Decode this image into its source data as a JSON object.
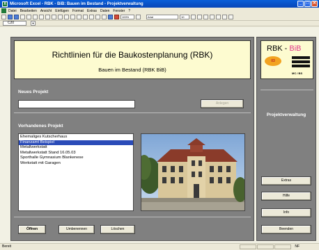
{
  "window": {
    "title": "Microsoft Excel - RBK - BiB: Bauen im Bestand - Projektverwaltung",
    "app_icon": "X",
    "buttons": [
      "_",
      "□",
      "✕"
    ]
  },
  "menu": {
    "items": [
      "Datei",
      "Bearbeiten",
      "Ansicht",
      "Einfügen",
      "Format",
      "Extras",
      "Daten",
      "Fenster",
      "?"
    ]
  },
  "toolbar": {
    "font_name": "Arial",
    "font_size": "10",
    "zoom": "100%"
  },
  "formula_bar": {
    "cell_ref": "C20",
    "dropdown_icon": "▼"
  },
  "header": {
    "title": "Richtlinien für die Baukostenplanung (RBK)",
    "subtitle": "Bauen im Bestand (RBK BiB)"
  },
  "new_project": {
    "label": "Neues Projekt",
    "input_value": "",
    "create_button": "Anlegen"
  },
  "existing_projects": {
    "label": "Vorhandenes Projekt",
    "items": [
      "Ehemaliges Kutscherhaus",
      "Finanzamt Beispiel",
      "Metallwerkstatt",
      "Metallwerkstatt Stand 16.05.03",
      "Sporthalle Gymnasium Blankenese",
      "Werkstatt mit Garagen"
    ],
    "selected_index": 1,
    "buttons": {
      "open": "Öffnen",
      "rename": "Umbenennen",
      "delete": "Löschen"
    }
  },
  "logo": {
    "rbk": "RBK - ",
    "bib": "BiB",
    "disc": "03",
    "small": "MC / BS"
  },
  "side": {
    "label": "Projektverwaltung",
    "buttons": [
      "Extras",
      "Hilfe",
      "Info",
      "Beenden"
    ]
  },
  "status": {
    "text": "Bereit",
    "nf": "NF"
  },
  "colors": {
    "panel_gray": "#808080",
    "header_yellow": "#fdfbd0",
    "selection_blue": "#2a4bb8",
    "logo_magenta": "#e23a8c"
  }
}
